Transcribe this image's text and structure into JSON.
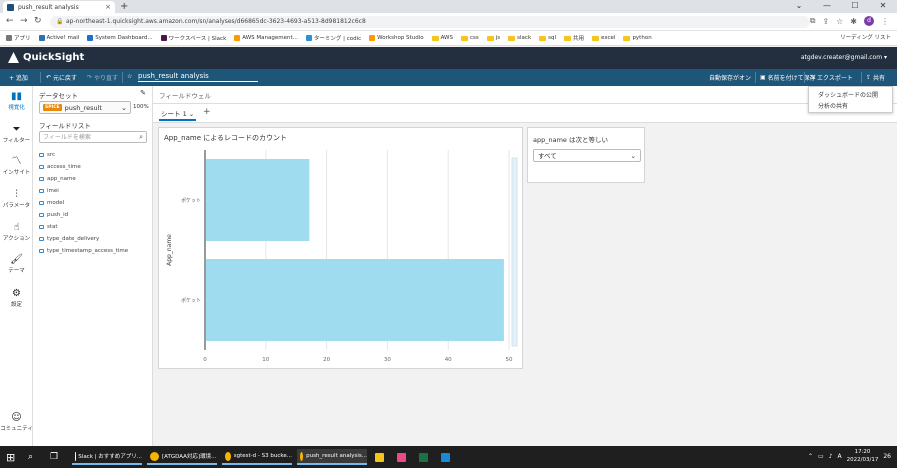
{
  "browser": {
    "tab_title": "push_result analysis",
    "url": "ap-northeast-1.quicksight.aws.amazon.com/sn/analyses/d66865dc-3623-4693-a513-8d981812c6c8",
    "bookmarks": [
      {
        "label": "アプリ",
        "kind": "grid"
      },
      {
        "label": "Active! mail",
        "kind": "site"
      },
      {
        "label": "System Dashboard...",
        "kind": "site"
      },
      {
        "label": "ワークスペース | Slack",
        "kind": "site"
      },
      {
        "label": "AWS Management...",
        "kind": "site"
      },
      {
        "label": "ターミング | codic",
        "kind": "site"
      },
      {
        "label": "Workshop Studio",
        "kind": "site"
      },
      {
        "label": "AWS",
        "kind": "folder"
      },
      {
        "label": "css",
        "kind": "folder"
      },
      {
        "label": "js",
        "kind": "folder"
      },
      {
        "label": "slack",
        "kind": "folder"
      },
      {
        "label": "sql",
        "kind": "folder"
      },
      {
        "label": "共用",
        "kind": "folder"
      },
      {
        "label": "excel",
        "kind": "folder"
      },
      {
        "label": "python",
        "kind": "folder"
      }
    ],
    "reading_list": "リーディング リスト",
    "profile_initial": "d"
  },
  "header": {
    "app_name": "QuickSight",
    "user": "atgdev.creater@gmail.com"
  },
  "toolbar": {
    "add": "+ 追加",
    "undo": "元に戻す",
    "redo": "やり直す",
    "analysis_name": "push_result analysis",
    "autosave": "自動保存がオン",
    "save_as": "名前を付けて保存",
    "export": "エクスポート",
    "share": "共有"
  },
  "share_menu": [
    "ダッシュボードの公開",
    "分析の共有"
  ],
  "rail": [
    {
      "label": "視覚化",
      "icon": "chart-icon"
    },
    {
      "label": "フィルター",
      "icon": "filter-icon"
    },
    {
      "label": "インサイト",
      "icon": "insight-icon"
    },
    {
      "label": "パラメータ",
      "icon": "parameter-icon"
    },
    {
      "label": "アクション",
      "icon": "action-icon"
    },
    {
      "label": "テーマ",
      "icon": "theme-icon"
    },
    {
      "label": "設定",
      "icon": "settings-icon"
    },
    {
      "label": "コミュニティ",
      "icon": "community-icon"
    }
  ],
  "data_panel": {
    "dataset_label": "データセット",
    "spice_badge": "SPICE",
    "dataset_name": "push_result",
    "dataset_pct": "100%",
    "field_list_label": "フィールドリスト",
    "search_placeholder": "フィールドを検索",
    "fields": [
      "src",
      "access_time",
      "app_name",
      "imei",
      "model",
      "push_id",
      "stat",
      "type_date_delivery",
      "type_timestamp_access_time"
    ]
  },
  "canvas": {
    "field_wells": "フィールドウェル",
    "sheet_tab": "シート 1"
  },
  "control": {
    "title": "app_name は次と等しい",
    "value": "すべて"
  },
  "visual": {
    "title": "App_name によるレコードのカウント"
  },
  "chart_data": {
    "type": "bar",
    "orientation": "horizontal",
    "title": "App_name によるレコードのカウント",
    "ylabel": "App_name",
    "xlabel": "",
    "categories": [
      "ポケット",
      "ポケット"
    ],
    "values": [
      17,
      49
    ],
    "xlim": [
      0,
      50
    ],
    "xticks": [
      0,
      10,
      20,
      30,
      40,
      50
    ],
    "grid": true,
    "color": "#a0dcef"
  },
  "taskbar": {
    "apps": [
      {
        "label": "Slack | おすすめアプリ...",
        "color": "#ffffff"
      },
      {
        "label": "[ATGDAA対応]環境...",
        "color": "#f4b400"
      },
      {
        "label": "sgtest-d - S3 bucke...",
        "color": "#f4b400"
      },
      {
        "label": "push_result analysis...",
        "color": "#f4b400",
        "active": true
      }
    ],
    "time": "17:20",
    "date": "2022/03/17",
    "notif": "26"
  }
}
